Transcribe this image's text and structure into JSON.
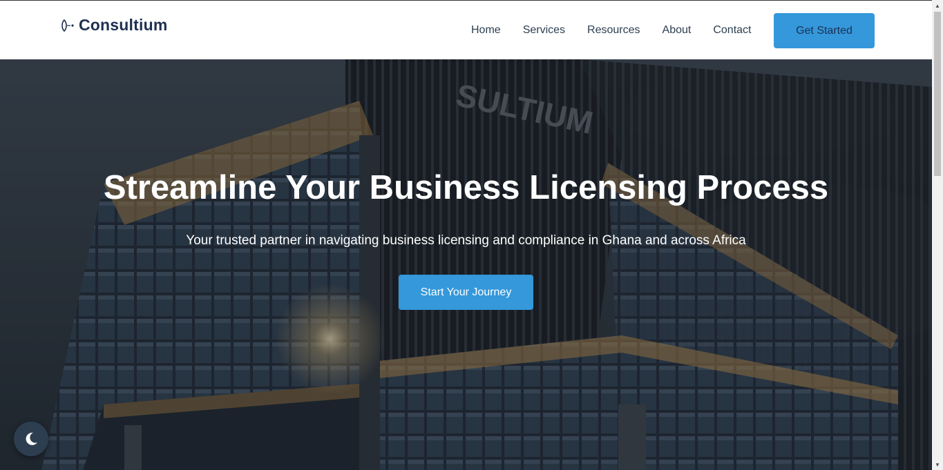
{
  "brand": {
    "name": "Consultium",
    "logo_icon": "logo-mark-icon"
  },
  "nav": {
    "items": [
      {
        "label": "Home"
      },
      {
        "label": "Services"
      },
      {
        "label": "Resources"
      },
      {
        "label": "About"
      },
      {
        "label": "Contact"
      }
    ],
    "cta_label": "Get Started"
  },
  "hero": {
    "title": "Streamline Your Business Licensing Process",
    "subtitle": "Your trusted partner in navigating business licensing and compliance in Ghana and across Africa",
    "cta_label": "Start Your Journey",
    "building_sign": "SULTIUM"
  },
  "theme_toggle": {
    "icon": "moon-icon"
  },
  "colors": {
    "accent": "#3498db",
    "brand_text": "#1e3050",
    "nav_text": "#2c3e50"
  }
}
